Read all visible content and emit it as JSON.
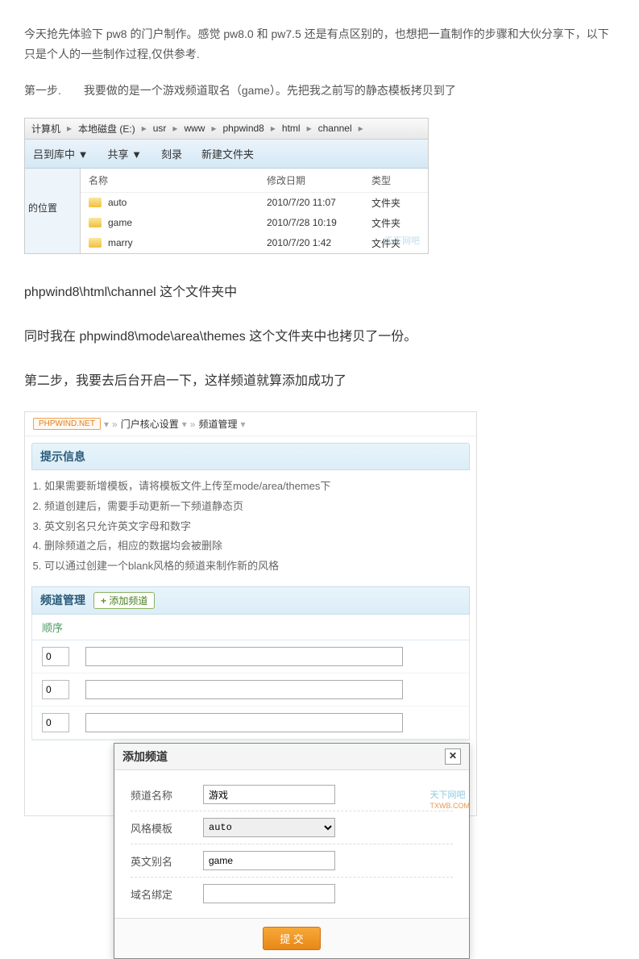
{
  "intro": {
    "p1": "今天抢先体验下 pw8 的门户制作。感觉 pw8.0 和 pw7.5 还是有点区别的，也想把一直制作的步骤和大伙分享下，以下只是个人的一些制作过程,仅供参考.",
    "p2": "第一步.  我要做的是一个游戏频道取名（game）。先把我之前写的静态模板拷贝到了"
  },
  "explorer": {
    "crumbs": [
      "计算机",
      "本地磁盘 (E:)",
      "usr",
      "www",
      "phpwind8",
      "html",
      "channel"
    ],
    "toolbar": [
      "吕到库中 ▼",
      "共享 ▼",
      "刻录",
      "新建文件夹"
    ],
    "side": "的位置",
    "headers": {
      "name": "名称",
      "date": "修改日期",
      "type": "类型"
    },
    "rows": [
      {
        "name": "auto",
        "date": "2010/7/20 11:07",
        "type": "文件夹"
      },
      {
        "name": "game",
        "date": "2010/7/28 10:19",
        "type": "文件夹"
      },
      {
        "name": "marry",
        "date": "2010/7/20 1:42",
        "type": "文件夹"
      }
    ],
    "watermark": "天下网吧"
  },
  "section": {
    "s1": "phpwind8\\html\\channel 这个文件夹中",
    "s2": "同时我在 phpwind8\\mode\\area\\themes 这个文件夹中也拷贝了一份。",
    "s3": "第二步，我要去后台开启一下，这样频道就算添加成功了"
  },
  "admin": {
    "logo": "PHPWIND.NET",
    "crumbs": [
      "门户核心设置",
      "频道管理"
    ],
    "info_title": "提示信息",
    "info_items": [
      "如果需要新增模板，请将模板文件上传至mode/area/themes下",
      "频道创建后，需要手动更新一下频道静态页",
      "英文别名只允许英文字母和数字",
      "删除频道之后，相应的数据均会被删除",
      "可以通过创建一个blank风格的频道来制作新的风格"
    ],
    "channel_title": "频道管理",
    "add_channel": "添加频道",
    "order_header": "顺序",
    "order_values": [
      "0",
      "0",
      "0"
    ],
    "dialog": {
      "title": "添加频道",
      "fields": {
        "name_label": "频道名称",
        "name_value": "游戏",
        "style_label": "风格模板",
        "style_value": "auto",
        "alias_label": "英文别名",
        "alias_value": "game",
        "domain_label": "域名绑定",
        "domain_value": ""
      },
      "submit": "提 交"
    },
    "wm_main": "天下网吧",
    "wm_sub": "TXWB.COM"
  }
}
